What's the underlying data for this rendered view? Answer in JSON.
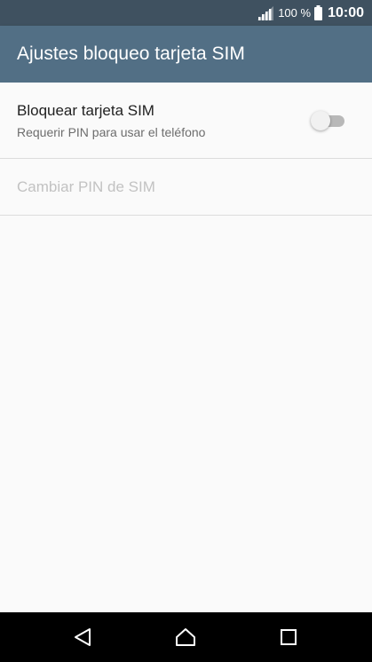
{
  "status_bar": {
    "battery_percent": "100 %",
    "time": "10:00",
    "icons": [
      "signal-icon",
      "battery-icon"
    ]
  },
  "app_bar": {
    "title": "Ajustes bloqueo tarjeta SIM"
  },
  "preferences": {
    "lock_sim": {
      "title": "Bloquear tarjeta SIM",
      "summary": "Requerir PIN para usar el teléfono",
      "enabled": false
    },
    "change_pin": {
      "title": "Cambiar PIN de SIM",
      "disabled": true
    }
  },
  "nav_bar": {
    "icons": [
      "back-icon",
      "home-icon",
      "recents-icon"
    ]
  },
  "colors": {
    "status_bar": "#3f5160",
    "app_bar": "#526f85",
    "background": "#fafafa",
    "nav_bar": "#000000"
  }
}
